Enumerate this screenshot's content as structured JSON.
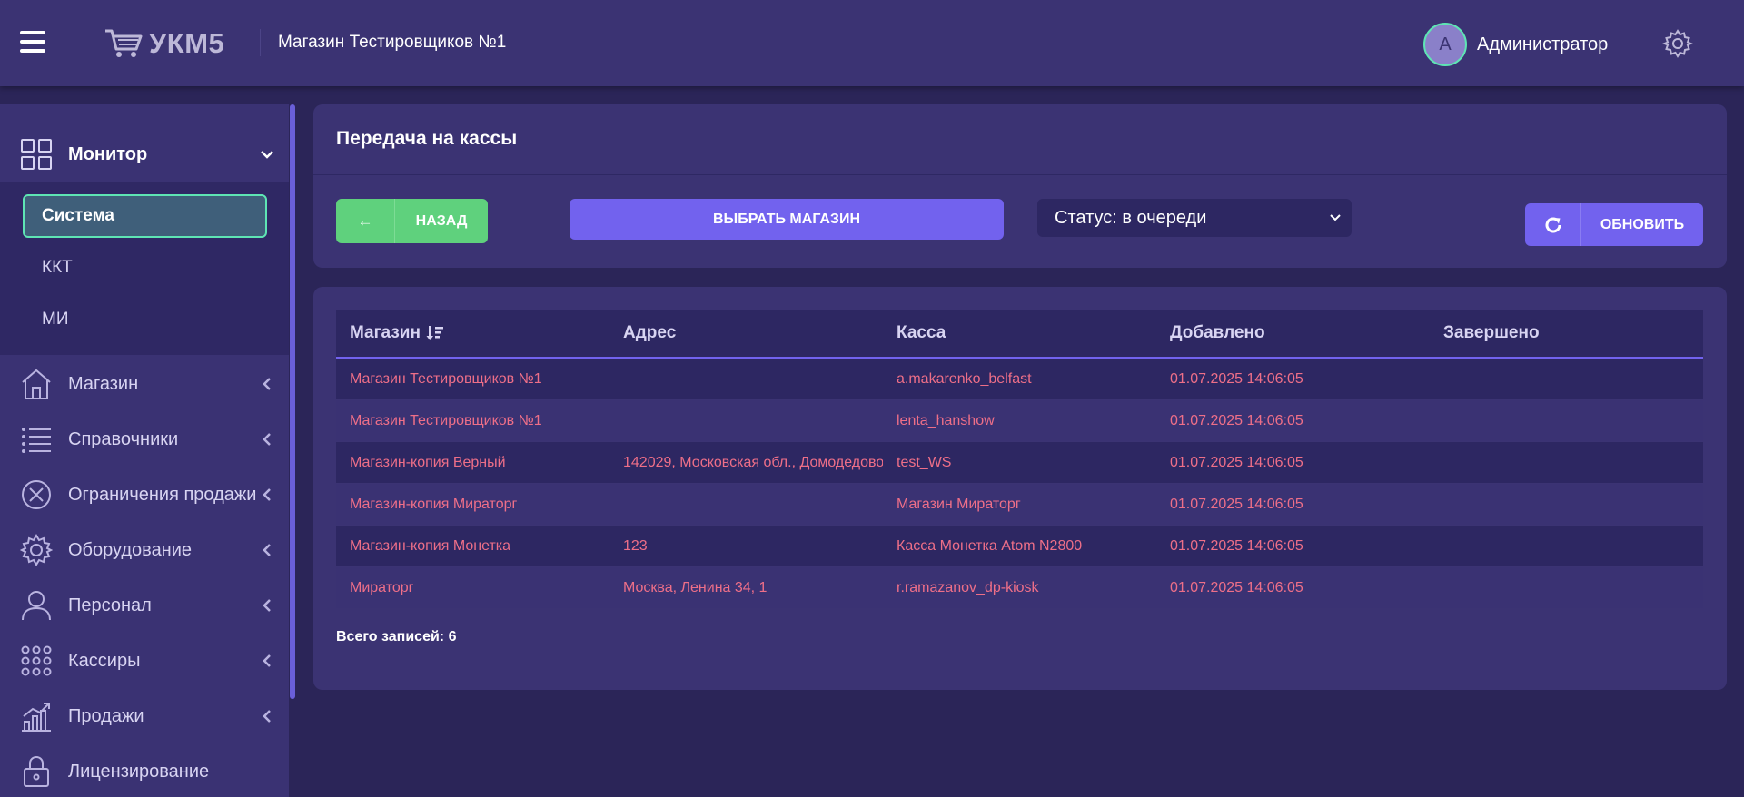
{
  "header": {
    "logo_text": "УКМ5",
    "store_title": "Магазин Тестировщиков №1",
    "avatar_letter": "A",
    "user_name": "Администратор"
  },
  "sidebar": {
    "items": [
      {
        "label": "Монитор",
        "icon": "dashboard-icon",
        "expanded": true
      },
      {
        "label": "Магазин",
        "icon": "store-icon"
      },
      {
        "label": "Справочники",
        "icon": "list-icon"
      },
      {
        "label": "Ограничения продажи",
        "icon": "restriction-icon"
      },
      {
        "label": "Оборудование",
        "icon": "gear-icon"
      },
      {
        "label": "Персонал",
        "icon": "person-icon"
      },
      {
        "label": "Кассиры",
        "icon": "grid-dots-icon"
      },
      {
        "label": "Продажи",
        "icon": "chart-icon"
      },
      {
        "label": "Лицензирование",
        "icon": "lock-icon"
      }
    ],
    "submenu": [
      {
        "label": "Система",
        "active": true
      },
      {
        "label": "ККТ"
      },
      {
        "label": "МИ"
      }
    ]
  },
  "main": {
    "title": "Передача на кассы",
    "back_arrow": "←",
    "back_label": "НАЗАД",
    "select_store_label": "ВЫБРАТЬ МАГАЗИН",
    "status_value": "Статус: в очереди",
    "refresh_label": "ОБНОВИТЬ"
  },
  "table": {
    "columns": [
      "Магазин",
      "Адрес",
      "Касса",
      "Добавлено",
      "Завершено"
    ],
    "rows": [
      [
        "Магазин Тестировщиков №1",
        "",
        "a.makarenko_belfast",
        "01.07.2025 14:06:05",
        ""
      ],
      [
        "Магазин Тестировщиков №1",
        "",
        "lenta_hanshow",
        "01.07.2025 14:06:05",
        ""
      ],
      [
        "Магазин-копия Верный",
        "142029, Московская обл., Домодедово",
        "test_WS",
        "01.07.2025 14:06:05",
        ""
      ],
      [
        "Магазин-копия Мираторг",
        "",
        "Магазин Мираторг",
        "01.07.2025 14:06:05",
        ""
      ],
      [
        "Магазин-копия Монетка",
        "123",
        "Касса Монетка Atom N2800",
        "01.07.2025 14:06:05",
        ""
      ],
      [
        "Мираторг",
        "Москва, Ленина 34, 1",
        "r.ramazanov_dp-kiosk",
        "01.07.2025 14:06:05",
        ""
      ]
    ],
    "total": "Всего записей: 6"
  },
  "colors": {
    "background": "#2b2558",
    "panel": "#3b3373",
    "accent": "#7262ee",
    "success": "#5fd17d",
    "highlight": "#5ee5b4",
    "link_text": "#ee6f88"
  }
}
